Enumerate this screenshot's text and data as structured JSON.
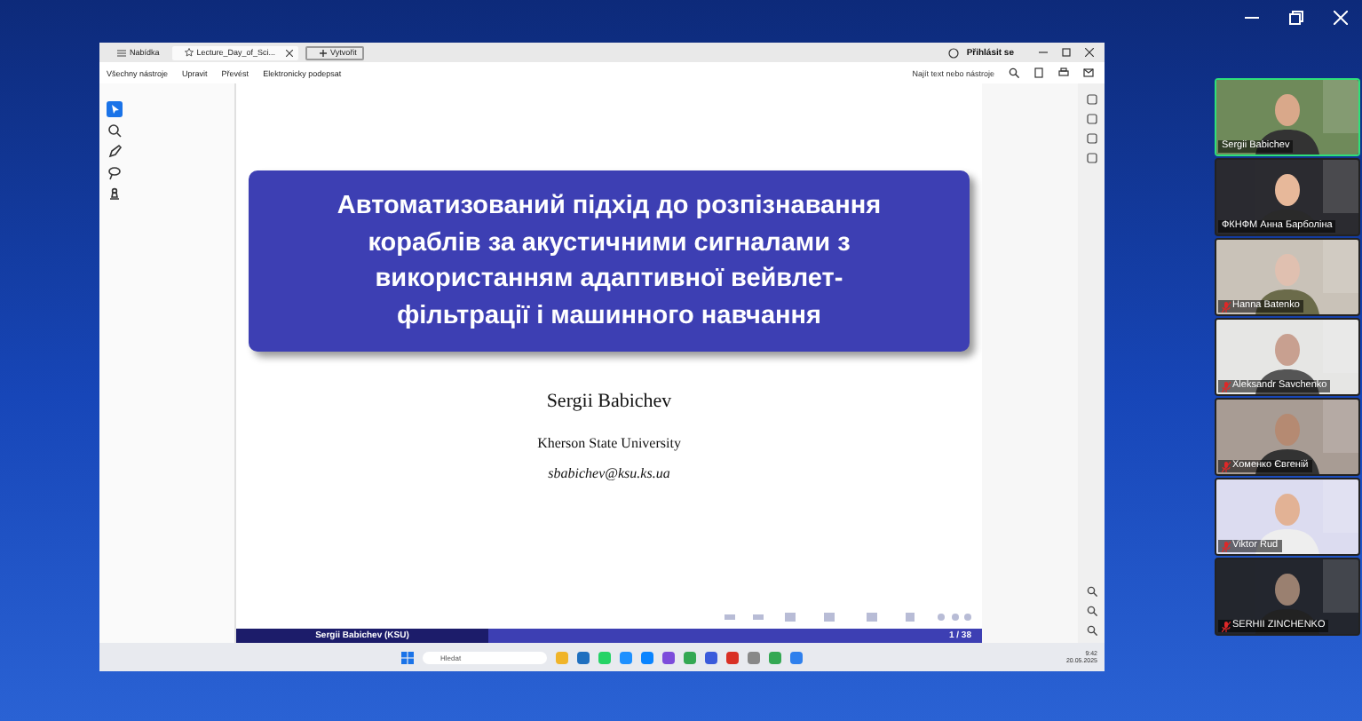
{
  "window": {
    "tabs": [
      {
        "label": "Nabídka",
        "kind": "menu",
        "selected": false
      },
      {
        "label": "Lecture_Day_of_Sci...",
        "kind": "document",
        "selected": true
      },
      {
        "label": "Vytvořit",
        "kind": "new",
        "selected": false
      }
    ],
    "sign_in": "Přihlásit se",
    "menu": [
      "Všechny nástroje",
      "Upravit",
      "Převést",
      "Elektronicky podepsat"
    ],
    "search": {
      "placeholder": "Najít text nebo nástroje"
    }
  },
  "slide": {
    "title": "Автоматизований підхід до розпізнавання кораблів за акустичними сигналами з використанням адаптивної вейвлет-фільтрації і машинного навчання",
    "author": "Sergii Babichev",
    "affiliation": "Kherson State University",
    "email": "sbabichev@ksu.ks.ua",
    "footer_author": "Sergii Babichev (KSU)",
    "page": "1 / 38"
  },
  "taskbar": {
    "search": {
      "placeholder": "Hledat"
    },
    "time": "9:42",
    "date": "20.05.2025"
  },
  "participants": [
    {
      "name": "Sergii Babichev",
      "muted": false,
      "speaking": true
    },
    {
      "name": "ФКНФМ Анна Барболіна",
      "muted": false,
      "speaking": false
    },
    {
      "name": "Hanna Batenko",
      "muted": true,
      "speaking": false
    },
    {
      "name": "Aleksandr Savchenko",
      "muted": true,
      "speaking": false
    },
    {
      "name": "Хоменко Євгеній",
      "muted": true,
      "speaking": false
    },
    {
      "name": "Viktor Rud",
      "muted": true,
      "speaking": false
    },
    {
      "name": "SERHII ZINCHENKO",
      "muted": true,
      "speaking": false
    }
  ]
}
